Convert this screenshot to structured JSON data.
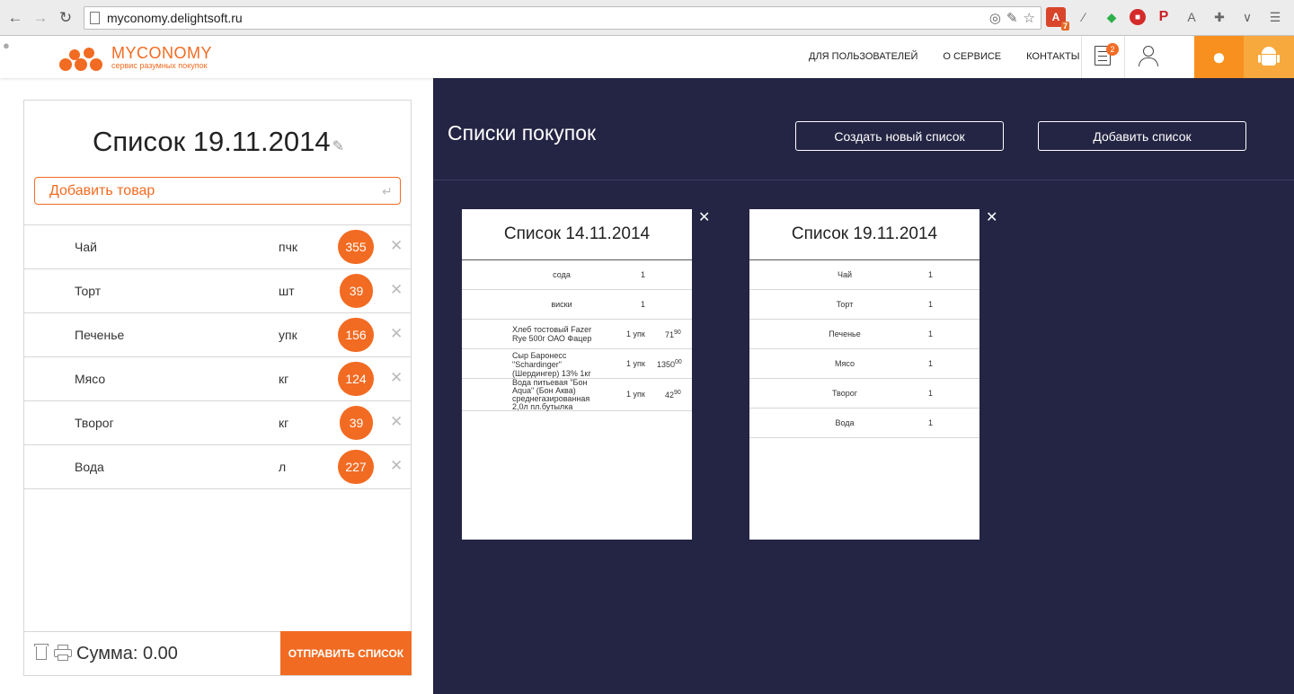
{
  "browser": {
    "url": "myconomy.delightsoft.ru",
    "ext_badge": "7"
  },
  "header": {
    "logo_name": "MYCONOMY",
    "logo_tagline": "сервис разумных покупок",
    "nav": [
      "ДЛЯ ПОЛЬЗОВАТЕЛЕЙ",
      "О СЕРВИСЕ",
      "КОНТАКТЫ"
    ],
    "lists_badge": "2",
    "colors": {
      "brand": "#f26b22",
      "apple_bg": "#f7901e",
      "android_bg": "#f7a93d"
    }
  },
  "left": {
    "title": "Список 19.11.2014",
    "add_placeholder": "Добавить товар",
    "items": [
      {
        "name": "Чай",
        "unit": "пчк",
        "price": "355"
      },
      {
        "name": "Торт",
        "unit": "шт",
        "price": "39"
      },
      {
        "name": "Печенье",
        "unit": "упк",
        "price": "156"
      },
      {
        "name": "Мясо",
        "unit": "кг",
        "price": "124"
      },
      {
        "name": "Творог",
        "unit": "кг",
        "price": "39"
      },
      {
        "name": "Вода",
        "unit": "л",
        "price": "227"
      }
    ],
    "sum_label": "Сумма: 0.00",
    "send_label": "ОТПРАВИТЬ СПИСОК"
  },
  "right": {
    "title": "Списки покупок",
    "create_label": "Создать новый список",
    "add_label": "Добавить список",
    "background": "#242444",
    "cards": [
      {
        "title": "Список 14.11.2014",
        "rows": [
          {
            "name": "сода",
            "qty": "1",
            "price": "",
            "cents": ""
          },
          {
            "name": "виски",
            "qty": "1",
            "price": "",
            "cents": ""
          },
          {
            "name": "Хлеб тостовый Fazer Rye 500г ОАО Фацер",
            "qty": "1 упк",
            "price": "71",
            "cents": "90"
          },
          {
            "name": "Сыр Баронесс \"Schardinger\" (Шердингер) 13% 1кг",
            "qty": "1 упк",
            "price": "1350",
            "cents": "00"
          },
          {
            "name": "Вода питьевая \"Бон Aqua\" (Бон Аква) среднегазированная 2,0л пл.бутылка",
            "qty": "1 упк",
            "price": "42",
            "cents": "90"
          }
        ]
      },
      {
        "title": "Список 19.11.2014",
        "rows": [
          {
            "name": "Чай",
            "qty": "1",
            "price": "",
            "cents": ""
          },
          {
            "name": "Торт",
            "qty": "1",
            "price": "",
            "cents": ""
          },
          {
            "name": "Печенье",
            "qty": "1",
            "price": "",
            "cents": ""
          },
          {
            "name": "Мясо",
            "qty": "1",
            "price": "",
            "cents": ""
          },
          {
            "name": "Творог",
            "qty": "1",
            "price": "",
            "cents": ""
          },
          {
            "name": "Вода",
            "qty": "1",
            "price": "",
            "cents": ""
          }
        ]
      }
    ]
  }
}
